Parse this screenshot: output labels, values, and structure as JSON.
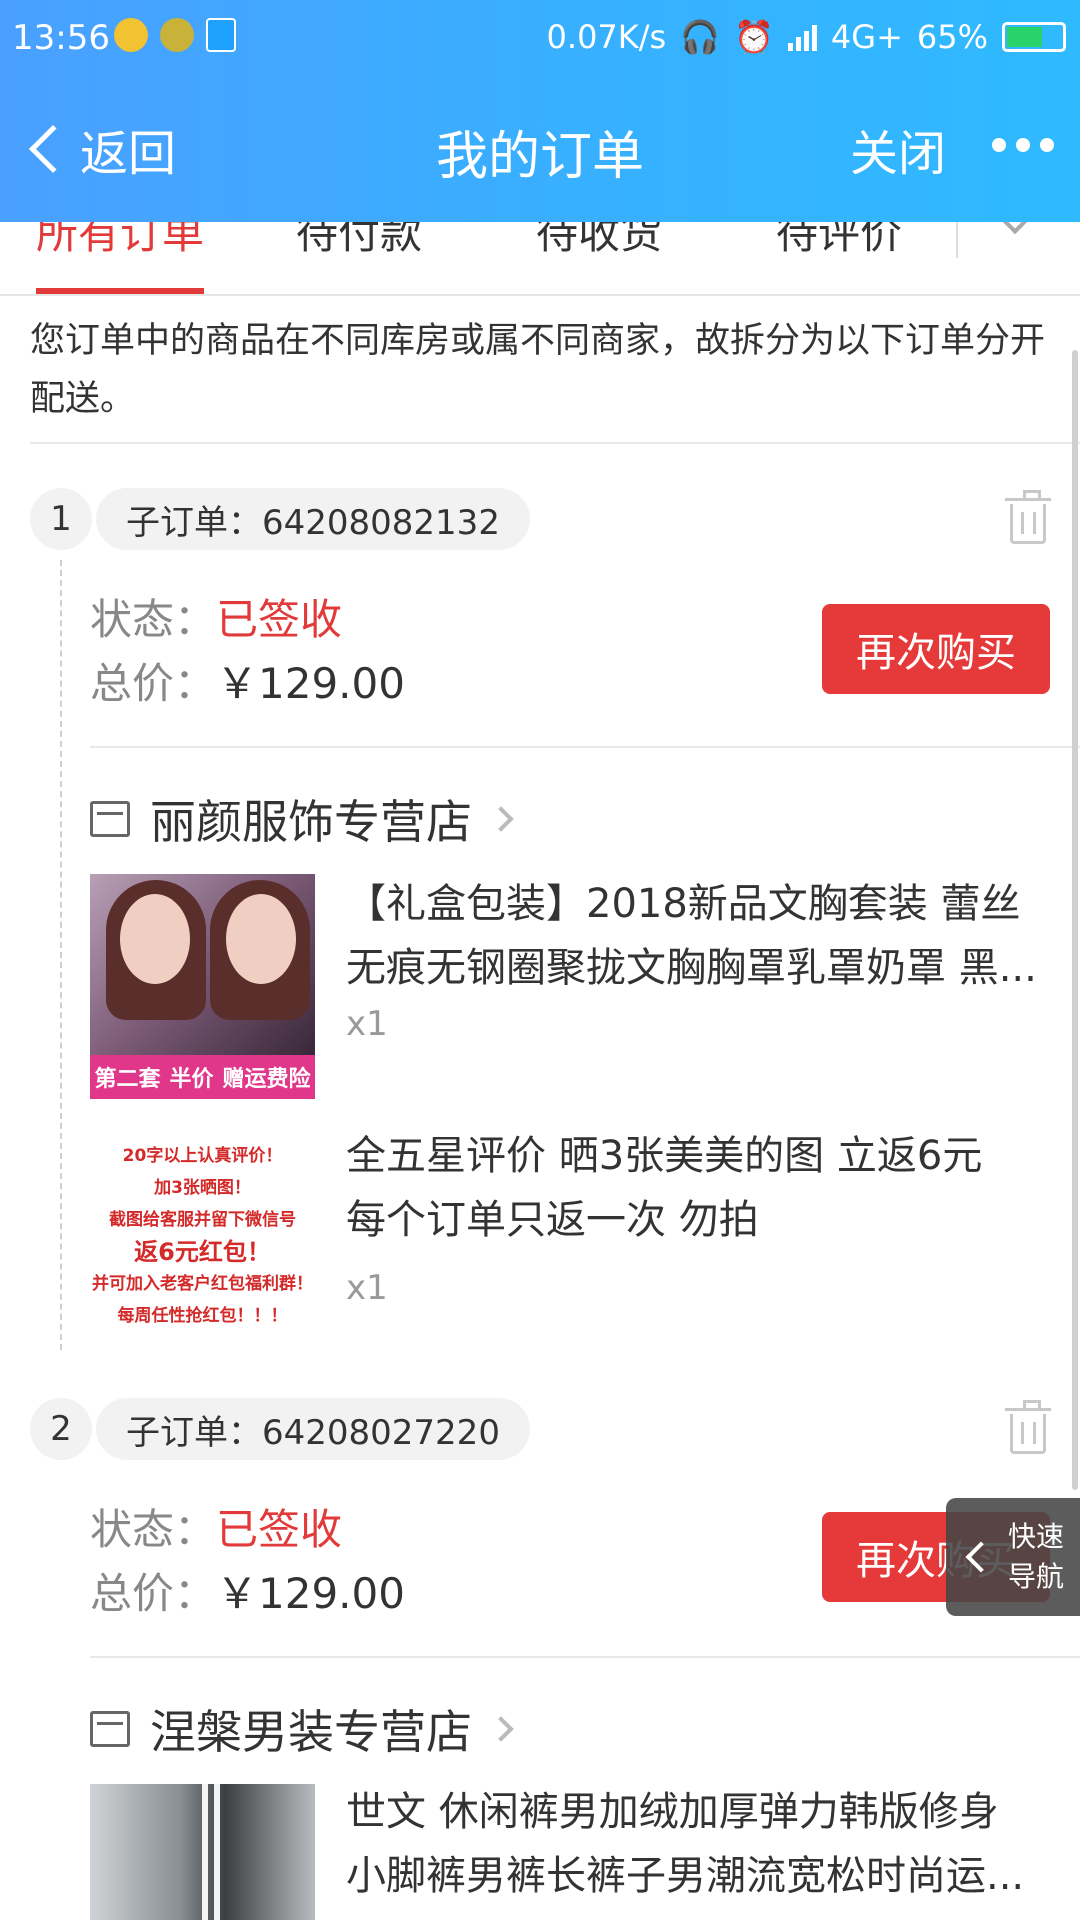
{
  "status_bar": {
    "time": "13:56",
    "net_speed": "0.07K/s",
    "network": "4G+",
    "battery": "65%",
    "battery_fraction": 0.65
  },
  "nav": {
    "back_label": "返回",
    "title": "我的订单",
    "close_label": "关闭"
  },
  "tabs": [
    {
      "label": "所有订单",
      "active": true
    },
    {
      "label": "待付款"
    },
    {
      "label": "待收货"
    },
    {
      "label": "待评价"
    }
  ],
  "notice": "您订单中的商品在不同库房或属不同商家，故拆分为以下订单分开配送。",
  "orders": [
    {
      "index": "1",
      "suborder": "子订单：64208082132",
      "status_label": "状态：",
      "status_value": "已签收",
      "price_label": "总价：",
      "price_value": "￥129.00",
      "rebuy_label": "再次购买",
      "shop": "丽颜服饰专营店",
      "items": [
        {
          "title_line1": "【礼盒包装】2018新品文胸套装 蕾丝",
          "title_line2": "无痕无钢圈聚拢文胸胸罩乳罩奶罩 黑...",
          "qty": "x1",
          "thumb_banner_left": "第二套",
          "thumb_banner_mid": "半价",
          "thumb_banner_right": "赠运费险"
        },
        {
          "title_line1": "全五星评价 晒3张美美的图 立返6元",
          "title_line2": "每个订单只返一次 勿拍",
          "qty": "x1",
          "promo_lines": [
            "20字以上认真评价！",
            "加3张晒图！",
            "截图给客服并留下微信号",
            "返6元红包！",
            "并可加入老客户红包福利群！",
            "每周任性抢红包！！！"
          ]
        }
      ]
    },
    {
      "index": "2",
      "suborder": "子订单：64208027220",
      "status_label": "状态：",
      "status_value": "已签收",
      "price_label": "总价：",
      "price_value": "￥129.00",
      "rebuy_label": "再次购买",
      "shop": "涅槃男装专营店",
      "items": [
        {
          "title_line1": "世文 休闲裤男加绒加厚弹力韩版修身",
          "title_line2": "小脚裤男裤长裤子男潮流宽松时尚运..."
        }
      ]
    }
  ],
  "quick_nav": {
    "line1": "快速",
    "line2": "导航"
  },
  "colors": {
    "header": "#37b0ff",
    "accent_red": "#e23a3a",
    "button_red": "#e63a3a"
  }
}
